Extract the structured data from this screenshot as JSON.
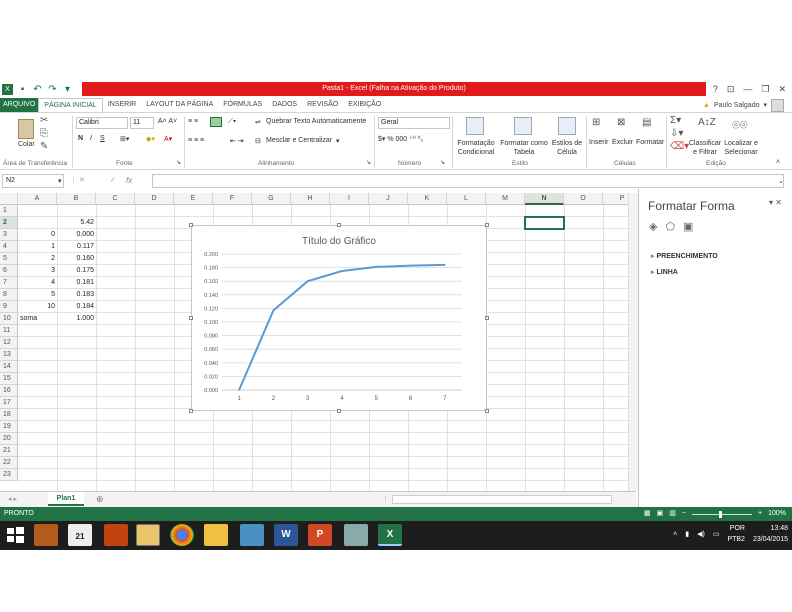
{
  "title_bar": {
    "title": "Pasta1 - Excel (Falha na Ativação do Produto)",
    "window_buttons": [
      "?",
      "⊡",
      "—",
      "❐",
      "✕"
    ]
  },
  "ribbon_tabs": [
    "ARQUIVO",
    "PÁGINA INICIAL",
    "INSERIR",
    "LAYOUT DA PÁGINA",
    "FÓRMULAS",
    "DADOS",
    "REVISÃO",
    "EXIBIÇÃO"
  ],
  "user": {
    "name": "Paulo Salgado"
  },
  "ribbon": {
    "paste_label": "Colar",
    "font_name": "Calibri",
    "font_size": "11",
    "wrap_text": "Quebrar Texto Automaticamente",
    "merge_center": "Mesclar e Centralizar",
    "number_format": "Geral",
    "cond_format": [
      "Formatação",
      "Condicional"
    ],
    "format_table": [
      "Formatar como",
      "Tabela"
    ],
    "cell_styles": [
      "Estilos de",
      "Célula"
    ],
    "insert": "Inserir",
    "delete": "Excluir",
    "format": "Formatar",
    "sort_filter": [
      "Classificar",
      "e Filtrar"
    ],
    "find_select": [
      "Localizar e",
      "Selecionar"
    ],
    "groups": {
      "clipboard": "Área de Transferência",
      "font": "Fonte",
      "alignment": "Alinhamento",
      "number": "Número",
      "styles": "Estilo",
      "cells": "Células",
      "editing": "Edição"
    }
  },
  "formula_bar": {
    "name_box": "N2",
    "fx": "fx",
    "value": ""
  },
  "columns": [
    "A",
    "B",
    "C",
    "D",
    "E",
    "F",
    "G",
    "H",
    "I",
    "J",
    "K",
    "L",
    "M",
    "N",
    "O",
    "P"
  ],
  "rows": [
    "1",
    "2",
    "3",
    "4",
    "5",
    "6",
    "7",
    "8",
    "9",
    "10",
    "11",
    "12",
    "13",
    "14",
    "15",
    "16",
    "17",
    "18",
    "19",
    "20",
    "21",
    "22",
    "23"
  ],
  "cells": [
    {
      "ref": "B2",
      "value": "5.42"
    },
    {
      "ref": "A3",
      "value": "0"
    },
    {
      "ref": "B3",
      "value": "0.000"
    },
    {
      "ref": "A4",
      "value": "1"
    },
    {
      "ref": "B4",
      "value": "0.117"
    },
    {
      "ref": "A5",
      "value": "2"
    },
    {
      "ref": "B5",
      "value": "0.160"
    },
    {
      "ref": "A6",
      "value": "3"
    },
    {
      "ref": "B6",
      "value": "0.175"
    },
    {
      "ref": "A7",
      "value": "4"
    },
    {
      "ref": "B7",
      "value": "0.181"
    },
    {
      "ref": "A8",
      "value": "5"
    },
    {
      "ref": "B8",
      "value": "0.183"
    },
    {
      "ref": "A9",
      "value": "10"
    },
    {
      "ref": "B9",
      "value": "0.184"
    },
    {
      "ref": "A10",
      "value": "soma"
    },
    {
      "ref": "B10",
      "value": "1.000"
    }
  ],
  "chart_data": {
    "type": "line",
    "title": "Título do Gráfico",
    "categories": [
      "1",
      "2",
      "3",
      "4",
      "5",
      "6",
      "7"
    ],
    "series": [
      {
        "values": [
          0.0,
          0.117,
          0.16,
          0.175,
          0.181,
          0.183,
          0.184
        ]
      }
    ],
    "ylim": [
      0,
      0.2
    ],
    "yticks": [
      "0.000",
      "0.020",
      "0.040",
      "0.060",
      "0.080",
      "0.100",
      "0.120",
      "0.140",
      "0.160",
      "0.180",
      "0.200"
    ],
    "grid": true,
    "color": "#5b9bd5"
  },
  "sheet_tabs": [
    "Plan1"
  ],
  "task_pane": {
    "title": "Formatar Forma",
    "sections": [
      "PREENCHIMENTO",
      "LINHA"
    ]
  },
  "status_bar": {
    "text": "PRONTO",
    "zoom": "100%"
  },
  "taskbar": {
    "lang": "POR",
    "layout": "PTB2",
    "time": "13:48",
    "date": "23/04/2015",
    "calendar_day": "21"
  },
  "colors": {
    "excel_green": "#217346",
    "title_red": "#e21a1a",
    "series_line": "#5b9bd5"
  }
}
